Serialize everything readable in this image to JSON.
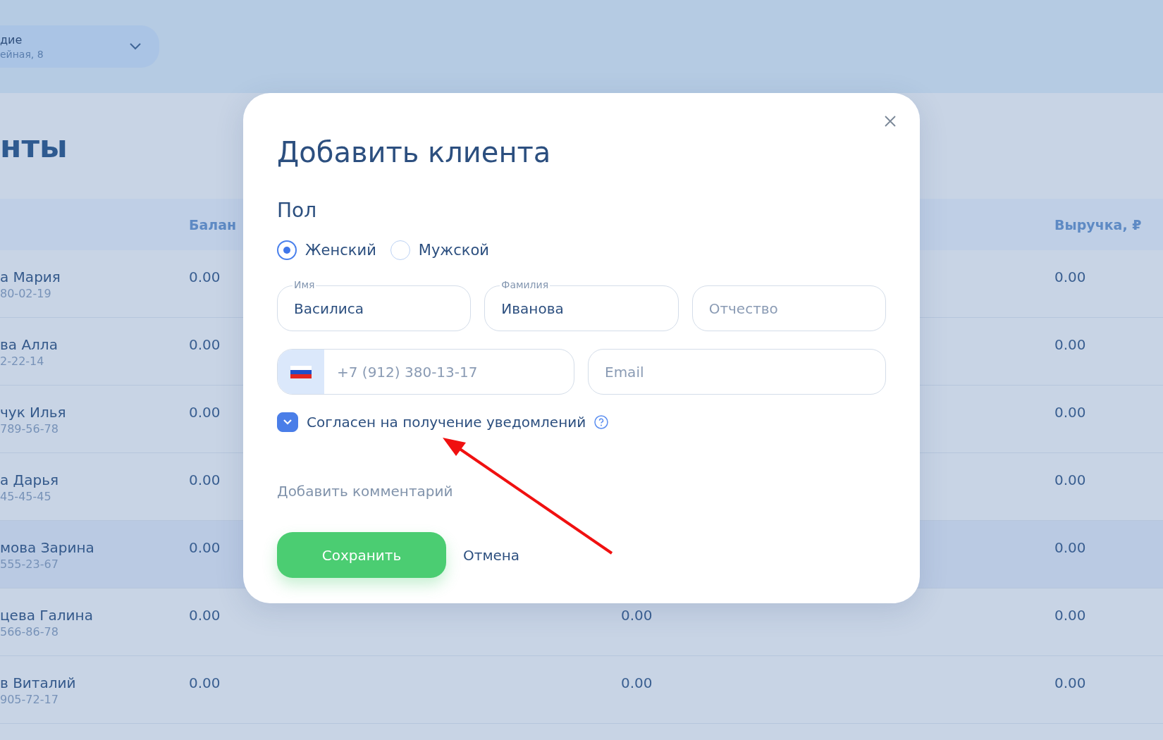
{
  "location_picker": {
    "name": "дие",
    "address": "ейная, 8"
  },
  "page_title": "нты",
  "table": {
    "headers": {
      "column_2": "Балан",
      "column_4": "Выручка, ₽"
    },
    "rows": [
      {
        "name": "а Мария",
        "phone": "80-02-19",
        "balance": "0.00",
        "revenue": "0.00",
        "selected": false
      },
      {
        "name": "ва Алла",
        "phone": "2-22-14",
        "balance": "0.00",
        "revenue": "0.00",
        "selected": false
      },
      {
        "name": "чук Илья",
        "phone": "789-56-78",
        "balance": "0.00",
        "revenue": "0.00",
        "selected": false
      },
      {
        "name": "а Дарья",
        "phone": "45-45-45",
        "balance": "0.00",
        "revenue": "0.00",
        "selected": false
      },
      {
        "name": "мова Зарина",
        "phone": "555-23-67",
        "balance": "0.00",
        "revenue": "0.00",
        "selected": true
      },
      {
        "name": "цева Галина",
        "phone": "566-86-78",
        "balance": "0.00",
        "column_3": "0.00",
        "revenue": "0.00",
        "selected": false
      },
      {
        "name": "в Виталий",
        "phone": "905-72-17",
        "balance": "0.00",
        "column_3": "0.00",
        "revenue": "0.00",
        "selected": false
      }
    ]
  },
  "dialog": {
    "title": "Добавить клиента",
    "gender_label": "Пол",
    "gender_options": [
      {
        "label": "Женский",
        "selected": true
      },
      {
        "label": "Мужской",
        "selected": false
      }
    ],
    "name_fields": [
      {
        "label": "Имя",
        "value": "Василиса"
      },
      {
        "label": "Фамилия",
        "value": "Иванова"
      },
      {
        "placeholder": "Отчество"
      }
    ],
    "phone": {
      "placeholder": "+7 (912) 380-13-17"
    },
    "email": {
      "placeholder": "Email"
    },
    "consent": {
      "label": "Согласен на получение уведомлений",
      "checked": true
    },
    "comment_link": "Добавить комментарий",
    "save_button": "Сохранить",
    "cancel_button": "Отмена"
  }
}
